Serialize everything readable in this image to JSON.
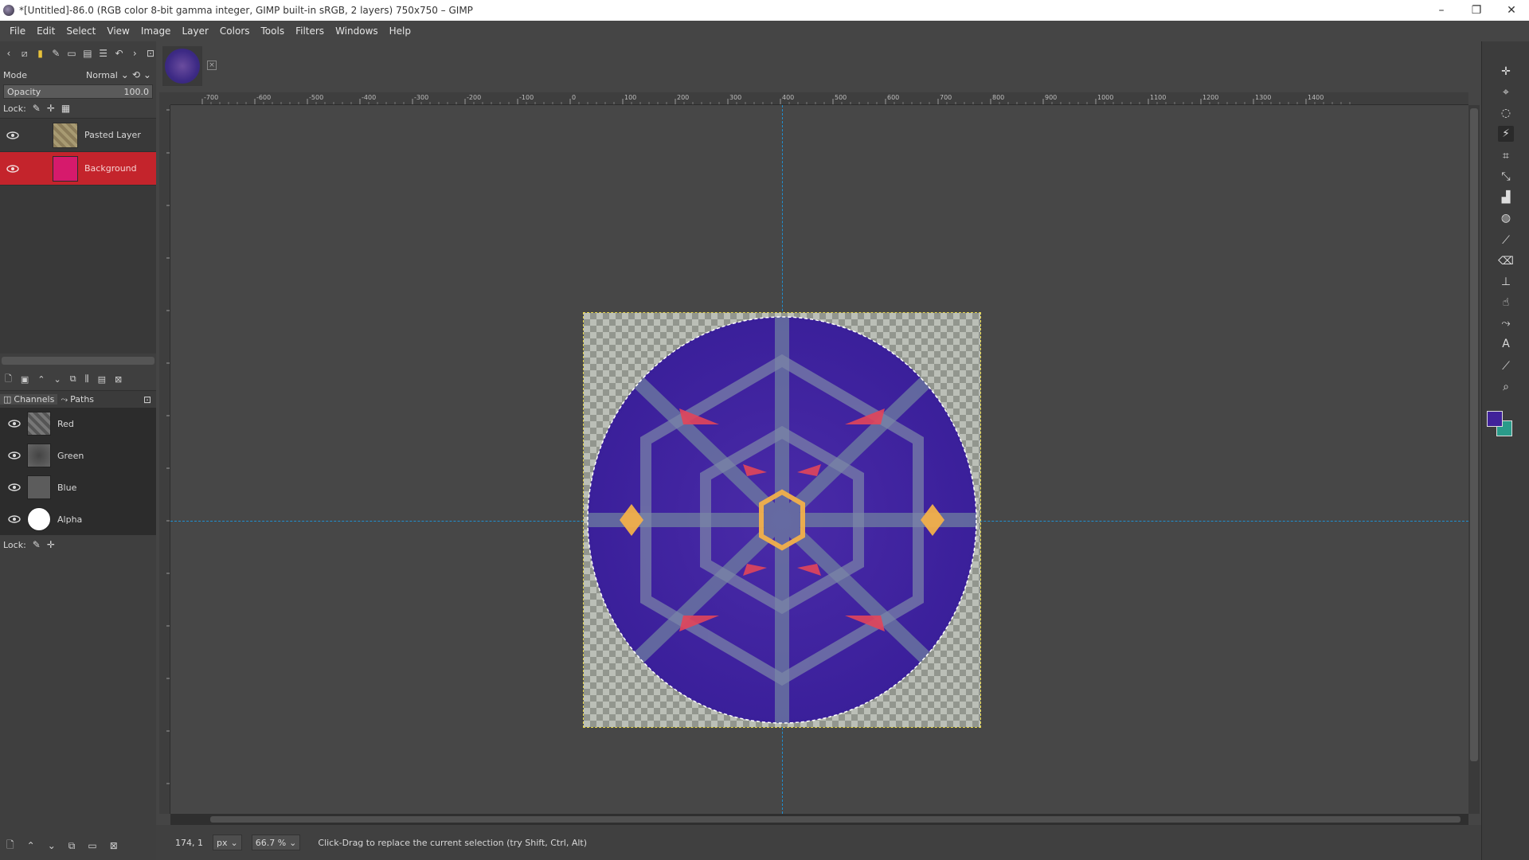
{
  "window": {
    "title": "*[Untitled]-86.0 (RGB color 8-bit gamma integer, GIMP built-in sRGB, 2 layers) 750x750 – GIMP",
    "minimize": "–",
    "maximize": "❐",
    "close": "✕"
  },
  "menu": [
    "File",
    "Edit",
    "Select",
    "View",
    "Image",
    "Layer",
    "Colors",
    "Tools",
    "Filters",
    "Windows",
    "Help"
  ],
  "layers_panel": {
    "mode_label": "Mode",
    "mode_value": "Normal",
    "opacity_label": "Opacity",
    "opacity_value": "100.0",
    "lock_label": "Lock:",
    "layers": [
      {
        "name": "Pasted Layer",
        "active": false
      },
      {
        "name": "Background",
        "active": true
      }
    ]
  },
  "channels_panel": {
    "tab_channels": "Channels",
    "tab_paths": "Paths",
    "channels": [
      "Red",
      "Green",
      "Blue",
      "Alpha"
    ],
    "lock_label": "Lock:"
  },
  "ruler_labels": [
    "-700",
    "-600",
    "-500",
    "-400",
    "-300",
    "-200",
    "-100",
    "0",
    "100",
    "200",
    "300",
    "400",
    "500",
    "600",
    "700",
    "800",
    "900",
    "1000",
    "1100",
    "1200",
    "1300",
    "1400"
  ],
  "status": {
    "coords": "174, 1",
    "unit": "px",
    "zoom": "66.7 %",
    "message": "Click-Drag to replace the current selection (try Shift, Ctrl, Alt)"
  },
  "colors": {
    "foreground": "#40229a",
    "background": "#2a9b8a",
    "active_layer": "#c4242c",
    "guide": "#1f8fd0"
  },
  "tool_icons": [
    "move-icon",
    "align-icon",
    "lasso-icon",
    "fuzzy-select-icon",
    "crop-icon",
    "transform-icon",
    "warp-icon",
    "bucket-fill-icon",
    "paintbrush-icon",
    "eraser-icon",
    "clone-icon",
    "smudge-icon",
    "paths-icon",
    "text-icon",
    "color-picker-icon",
    "zoom-icon"
  ]
}
